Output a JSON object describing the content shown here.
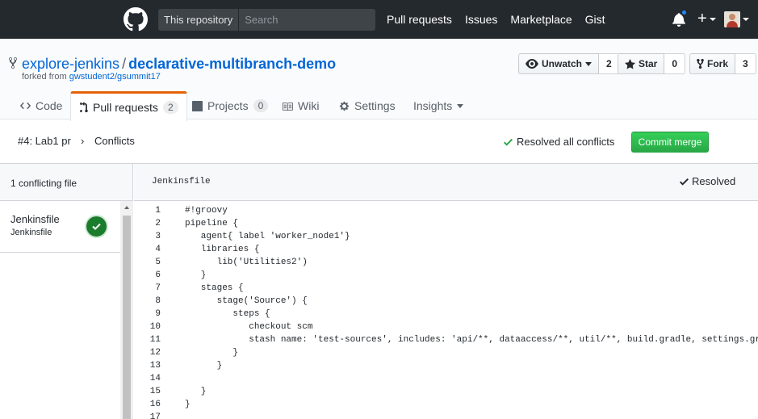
{
  "topbar": {
    "scope_label": "This repository",
    "search_placeholder": "Search",
    "nav": [
      "Pull requests",
      "Issues",
      "Marketplace",
      "Gist"
    ],
    "plus": "+"
  },
  "repo": {
    "owner": "explore-jenkins",
    "separator": "/",
    "name": "declarative-multibranch-demo",
    "forked_prefix": "forked from",
    "forked_link": "gwstudent2/gsummit17"
  },
  "actions": {
    "watch_label": "Unwatch",
    "watch_count": "2",
    "star_label": "Star",
    "star_count": "0",
    "fork_label": "Fork",
    "fork_count": "3"
  },
  "tabs": {
    "code": "Code",
    "pulls": "Pull requests",
    "pulls_count": "2",
    "projects": "Projects",
    "projects_count": "0",
    "wiki": "Wiki",
    "settings": "Settings",
    "insights": "Insights"
  },
  "breadcrumb": {
    "pr": "#4: Lab1 pr",
    "arrow": "›",
    "page": "Conflicts"
  },
  "conflict_bar": {
    "resolved_all": "Resolved all conflicts",
    "commit_label": "Commit merge"
  },
  "files": {
    "count_label": "1 conflicting file",
    "items": [
      {
        "name": "Jenkinsfile",
        "path": "Jenkinsfile"
      }
    ]
  },
  "editor": {
    "file_name": "Jenkinsfile",
    "resolved_label": "Resolved",
    "lines": [
      {
        "n": "1",
        "text": "#!groovy"
      },
      {
        "n": "2",
        "text": "pipeline {"
      },
      {
        "n": "3",
        "text": "   agent{ label 'worker_node1'}"
      },
      {
        "n": "4",
        "text": "   libraries {"
      },
      {
        "n": "5",
        "text": "      lib('Utilities2')"
      },
      {
        "n": "6",
        "text": "   }"
      },
      {
        "n": "7",
        "text": "   stages {"
      },
      {
        "n": "8",
        "text": "      stage('Source') {"
      },
      {
        "n": "9",
        "text": "         steps {"
      },
      {
        "n": "10",
        "text": "            checkout scm"
      },
      {
        "n": "11",
        "text": "            stash name: 'test-sources', includes: 'api/**, dataaccess/**, util/**, build.gradle, settings.gradle'"
      },
      {
        "n": "12",
        "text": "         }"
      },
      {
        "n": "13",
        "text": "      }"
      },
      {
        "n": "14",
        "text": ""
      },
      {
        "n": "15",
        "text": "   }"
      },
      {
        "n": "16",
        "text": "}"
      },
      {
        "n": "17",
        "text": ""
      }
    ]
  },
  "colors": {
    "topbar": "#24292e",
    "link": "#0366d6",
    "commit_button": "#28a745",
    "tab_accent": "#e36209",
    "resolved_badge": "#1c7c2d"
  }
}
